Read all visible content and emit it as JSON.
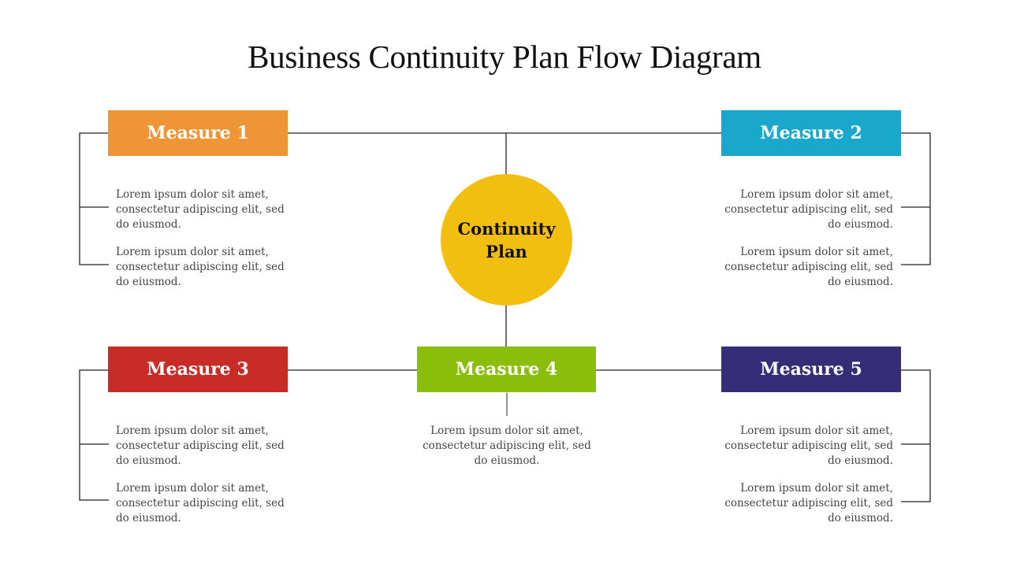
{
  "title": "Business Continuity Plan Flow Diagram",
  "center": {
    "label": "Continuity Plan",
    "color": "#F2BE0F"
  },
  "measures": [
    {
      "label": "Measure 1",
      "color": "#EE9537",
      "items": [
        "Lorem ipsum dolor sit amet, consectetur adipiscing elit, sed do eiusmod.",
        "Lorem ipsum dolor sit amet, consectetur adipiscing elit, sed do eiusmod."
      ]
    },
    {
      "label": "Measure 2",
      "color": "#19A8CC",
      "items": [
        "Lorem ipsum dolor sit amet, consectetur adipiscing elit, sed do eiusmod.",
        "Lorem ipsum dolor sit amet, consectetur adipiscing elit, sed do eiusmod."
      ]
    },
    {
      "label": "Measure 3",
      "color": "#C72C27",
      "items": [
        "Lorem ipsum dolor sit amet, consectetur adipiscing elit, sed do eiusmod.",
        "Lorem ipsum dolor sit amet, consectetur adipiscing elit, sed do eiusmod."
      ]
    },
    {
      "label": "Measure 4",
      "color": "#8BBD0C",
      "items": [
        "Lorem ipsum dolor sit amet, consectetur adipiscing elit, sed do eiusmod."
      ]
    },
    {
      "label": "Measure 5",
      "color": "#352D76",
      "items": [
        "Lorem ipsum dolor sit amet, consectetur adipiscing elit, sed do eiusmod.",
        "Lorem ipsum dolor sit amet, consectetur adipiscing elit, sed do eiusmod."
      ]
    }
  ]
}
